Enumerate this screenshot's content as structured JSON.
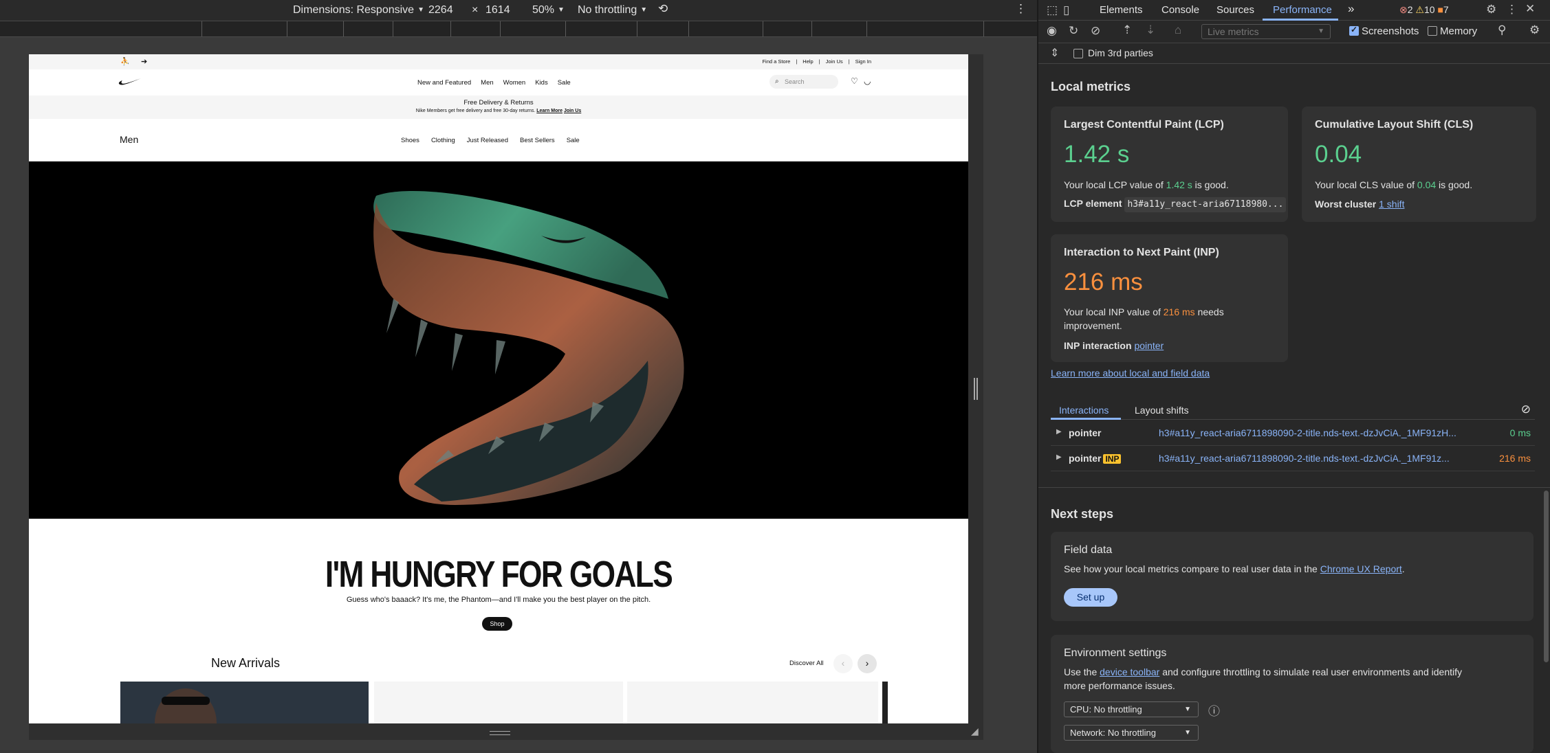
{
  "devbar": {
    "dimensions": "Dimensions: Responsive",
    "width": "2264",
    "times": "×",
    "height": "1614",
    "zoom": "50%",
    "throttling": "No throttling"
  },
  "site": {
    "util_links": [
      "Find a Store",
      "|",
      "Help",
      "|",
      "Join Us",
      "|",
      "Sign In"
    ],
    "nav_links": [
      "New and Featured",
      "Men",
      "Women",
      "Kids",
      "Sale"
    ],
    "search_placeholder": "Search",
    "promo_title": "Free Delivery & Returns",
    "promo_text": "Nike Members get free delivery and free 30-day returns.",
    "promo_link": "Learn More",
    "promo_link2": "Join Us",
    "subnav_title": "Men",
    "subnav_links": [
      "Shoes",
      "Clothing",
      "Just Released",
      "Best Sellers",
      "Sale"
    ],
    "headline": "I'M HUNGRY FOR GOALS",
    "subline": "Guess who's baaack? It's me, the Phantom—and I'll make you the best player on the pitch.",
    "shop_label": "Shop",
    "new_arrivals": "New Arrivals",
    "discover_all": "Discover All"
  },
  "devtools": {
    "tabs": [
      "Elements",
      "Console",
      "Sources",
      "Performance"
    ],
    "issue_errors": "2",
    "issue_warnings": "10",
    "issue_info": "7",
    "live_metrics_select": "Live metrics",
    "screenshots_label": "Screenshots",
    "memory_label": "Memory",
    "dim_3rd_parties": "Dim 3rd parties",
    "local_metrics_title": "Local metrics",
    "lcp": {
      "title": "Largest Contentful Paint (LCP)",
      "value": "1.42 s",
      "text_pre": "Your local LCP value of ",
      "text_val": "1.42 s",
      "text_post": " is good.",
      "element_label": "LCP element",
      "element_value": "h3#a11y_react-aria67118980..."
    },
    "cls": {
      "title": "Cumulative Layout Shift (CLS)",
      "value": "0.04",
      "text_pre": "Your local CLS value of ",
      "text_val": "0.04",
      "text_post": " is good.",
      "worst_label": "Worst cluster",
      "worst_value": "1 shift"
    },
    "inp": {
      "title": "Interaction to Next Paint (INP)",
      "value": "216 ms",
      "text_pre": "Your local INP value of ",
      "text_val": "216 ms",
      "text_post": " needs",
      "text_line2": "improvement.",
      "interaction_label": "INP interaction",
      "interaction_value": "pointer"
    },
    "learn_more": "Learn more about local and field data",
    "interaction_tabs": [
      "Interactions",
      "Layout shifts"
    ],
    "interactions": [
      {
        "type": "pointer",
        "badge": "",
        "selector": "h3#a11y_react-aria6711898090-2-title.nds-text.-dzJvCiA._1MF91zH...",
        "value": "0 ms"
      },
      {
        "type": "pointer",
        "badge": "INP",
        "selector": "h3#a11y_react-aria6711898090-2-title.nds-text.-dzJvCiA._1MF91z...",
        "value": "216 ms"
      }
    ],
    "next_steps_title": "Next steps",
    "field_data": {
      "title": "Field data",
      "text_pre": "See how your local metrics compare to real user data in the ",
      "link": "Chrome UX Report",
      "text_post": ".",
      "button": "Set up"
    },
    "env": {
      "title": "Environment settings",
      "text_pre": "Use the ",
      "link": "device toolbar",
      "text_post": " and configure throttling to simulate real user environments and identify",
      "text_line2": "more performance issues.",
      "cpu": "CPU: No throttling",
      "network": "Network: No throttling"
    }
  },
  "colors": {
    "good": "#5bd08f",
    "needs_improvement": "#fa903e",
    "accent": "#8ab4f8"
  }
}
